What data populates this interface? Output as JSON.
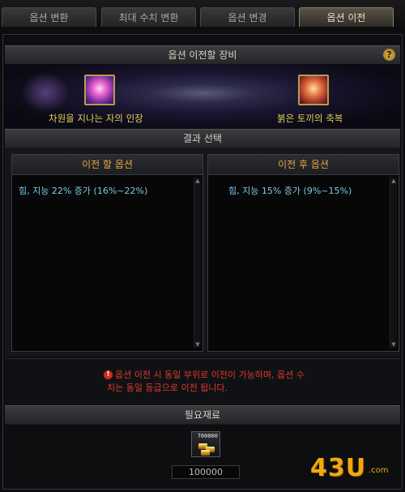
{
  "tabs": [
    {
      "label": "옵션 변환"
    },
    {
      "label": "최대 수치 변환"
    },
    {
      "label": "옵션 변경"
    },
    {
      "label": "옵션 이전"
    }
  ],
  "equip_section": {
    "title": "옵션 이전할 장비",
    "help": "?",
    "source_item": "차원을 지나는 자의 인장",
    "target_item": "붉은 토끼의 축복"
  },
  "result_section": {
    "title": "결과 선택",
    "before": {
      "title": "이전 할 옵션",
      "option": "힘, 지능 22% 증가 (16%~22%)"
    },
    "after": {
      "title": "이전 후 옵션",
      "option": "힘, 지능 15% 증가 (9%~15%)"
    }
  },
  "warning": {
    "icon": "!",
    "line1": "옵션 이전 시 동일 부위로 이전이 가능하며, 옵션 수",
    "line2": "치는 동일 등급으로 이전 됩니다."
  },
  "materials": {
    "title": "필요재료",
    "item_count": "700000",
    "value": "100000"
  },
  "watermark": {
    "text": "43U",
    "suffix": ".com"
  }
}
